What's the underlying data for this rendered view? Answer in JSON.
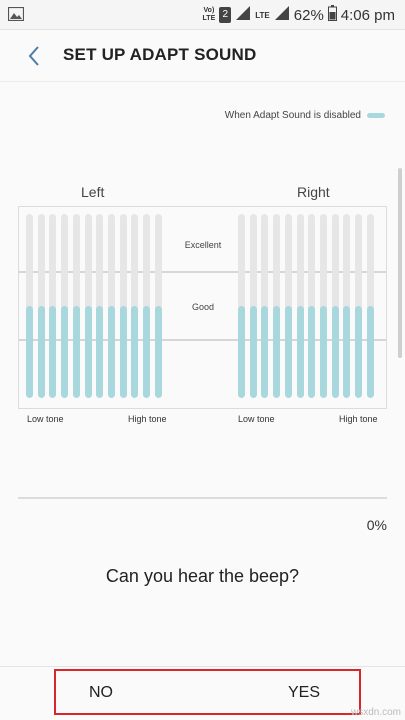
{
  "status_bar": {
    "volte": "Vo)\nLTE",
    "sim": "2",
    "lte": "LTE",
    "battery": "62%",
    "time": "4:06 pm"
  },
  "header": {
    "title": "SET UP ADAPT SOUND"
  },
  "legend": {
    "label": "When Adapt Sound is disabled",
    "color": "#a8d8de"
  },
  "channels": {
    "left": "Left",
    "right": "Right"
  },
  "levels": {
    "excellent": "Excellent",
    "good": "Good"
  },
  "tone_labels": {
    "low": "Low tone",
    "high": "High tone"
  },
  "chart_data": {
    "type": "bar",
    "series": [
      {
        "name": "Left",
        "values": [
          0.5,
          0.5,
          0.5,
          0.5,
          0.5,
          0.5,
          0.5,
          0.5,
          0.5,
          0.5,
          0.5,
          0.5
        ]
      },
      {
        "name": "Right",
        "values": [
          0.5,
          0.5,
          0.5,
          0.5,
          0.5,
          0.5,
          0.5,
          0.5,
          0.5,
          0.5,
          0.5,
          0.5
        ]
      }
    ],
    "fill_color": "#a8d8de",
    "track_color": "#e6e6e6"
  },
  "progress": {
    "value": 0,
    "text": "0%"
  },
  "question": "Can you hear the beep?",
  "buttons": {
    "no": "NO",
    "yes": "YES"
  },
  "watermark": "wsxdn.com"
}
